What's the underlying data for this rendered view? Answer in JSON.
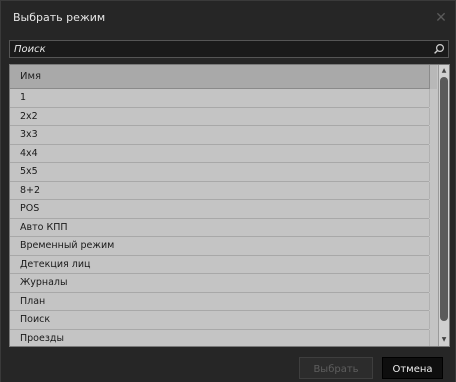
{
  "dialog": {
    "title": "Выбрать режим",
    "close_icon": "close-icon"
  },
  "search": {
    "placeholder": "Поиск",
    "icon": "search-icon"
  },
  "list": {
    "column_header": "Имя",
    "items": [
      "1",
      "2x2",
      "3x3",
      "4x4",
      "5x5",
      "8+2",
      "POS",
      "Авто КПП",
      "Временный режим",
      "Детекция лиц",
      "Журналы",
      "План",
      "Поиск",
      "Проезды"
    ]
  },
  "footer": {
    "select_label": "Выбрать",
    "cancel_label": "Отмена"
  }
}
